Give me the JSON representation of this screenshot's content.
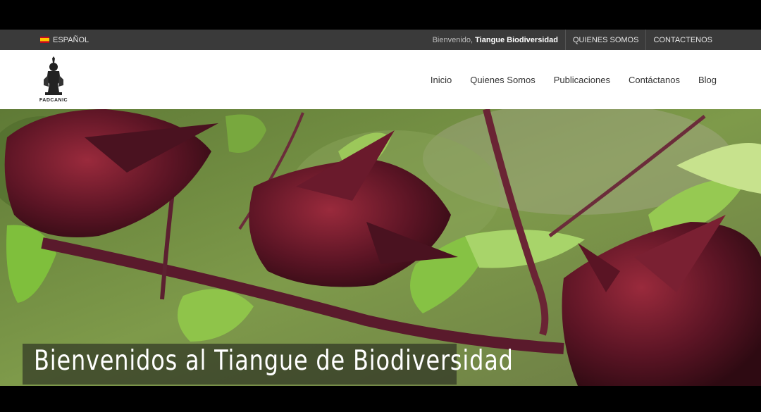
{
  "topbar": {
    "language": "ESPAÑOL",
    "welcome_prefix": "Bienvenido,",
    "welcome_name": "Tiangue Biodiversidad",
    "links": [
      "QUIENES SOMOS",
      "CONTACTENOS"
    ]
  },
  "header": {
    "logo_text": "FADCANIC",
    "nav": [
      "Inicio",
      "Quienes Somos",
      "Publicaciones",
      "Contáctanos",
      "Blog"
    ]
  },
  "hero": {
    "caption": "Bienvenidos al Tiangue de Biodiversidad"
  }
}
